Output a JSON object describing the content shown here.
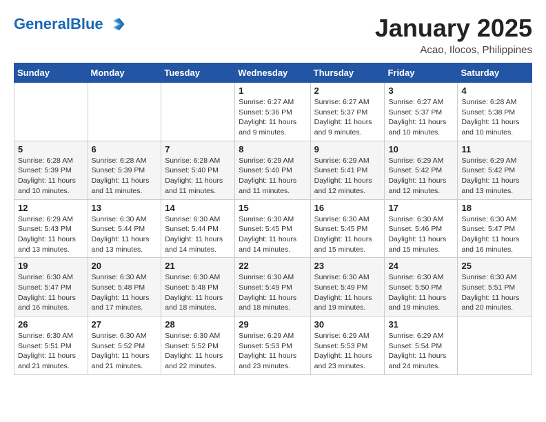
{
  "header": {
    "logo_line1": "General",
    "logo_line2": "Blue",
    "month": "January 2025",
    "location": "Acao, Ilocos, Philippines"
  },
  "weekdays": [
    "Sunday",
    "Monday",
    "Tuesday",
    "Wednesday",
    "Thursday",
    "Friday",
    "Saturday"
  ],
  "weeks": [
    [
      {
        "day": "",
        "detail": ""
      },
      {
        "day": "",
        "detail": ""
      },
      {
        "day": "",
        "detail": ""
      },
      {
        "day": "1",
        "detail": "Sunrise: 6:27 AM\nSunset: 5:36 PM\nDaylight: 11 hours and 9 minutes."
      },
      {
        "day": "2",
        "detail": "Sunrise: 6:27 AM\nSunset: 5:37 PM\nDaylight: 11 hours and 9 minutes."
      },
      {
        "day": "3",
        "detail": "Sunrise: 6:27 AM\nSunset: 5:37 PM\nDaylight: 11 hours and 10 minutes."
      },
      {
        "day": "4",
        "detail": "Sunrise: 6:28 AM\nSunset: 5:38 PM\nDaylight: 11 hours and 10 minutes."
      }
    ],
    [
      {
        "day": "5",
        "detail": "Sunrise: 6:28 AM\nSunset: 5:39 PM\nDaylight: 11 hours and 10 minutes."
      },
      {
        "day": "6",
        "detail": "Sunrise: 6:28 AM\nSunset: 5:39 PM\nDaylight: 11 hours and 11 minutes."
      },
      {
        "day": "7",
        "detail": "Sunrise: 6:28 AM\nSunset: 5:40 PM\nDaylight: 11 hours and 11 minutes."
      },
      {
        "day": "8",
        "detail": "Sunrise: 6:29 AM\nSunset: 5:40 PM\nDaylight: 11 hours and 11 minutes."
      },
      {
        "day": "9",
        "detail": "Sunrise: 6:29 AM\nSunset: 5:41 PM\nDaylight: 11 hours and 12 minutes."
      },
      {
        "day": "10",
        "detail": "Sunrise: 6:29 AM\nSunset: 5:42 PM\nDaylight: 11 hours and 12 minutes."
      },
      {
        "day": "11",
        "detail": "Sunrise: 6:29 AM\nSunset: 5:42 PM\nDaylight: 11 hours and 13 minutes."
      }
    ],
    [
      {
        "day": "12",
        "detail": "Sunrise: 6:29 AM\nSunset: 5:43 PM\nDaylight: 11 hours and 13 minutes."
      },
      {
        "day": "13",
        "detail": "Sunrise: 6:30 AM\nSunset: 5:44 PM\nDaylight: 11 hours and 13 minutes."
      },
      {
        "day": "14",
        "detail": "Sunrise: 6:30 AM\nSunset: 5:44 PM\nDaylight: 11 hours and 14 minutes."
      },
      {
        "day": "15",
        "detail": "Sunrise: 6:30 AM\nSunset: 5:45 PM\nDaylight: 11 hours and 14 minutes."
      },
      {
        "day": "16",
        "detail": "Sunrise: 6:30 AM\nSunset: 5:45 PM\nDaylight: 11 hours and 15 minutes."
      },
      {
        "day": "17",
        "detail": "Sunrise: 6:30 AM\nSunset: 5:46 PM\nDaylight: 11 hours and 15 minutes."
      },
      {
        "day": "18",
        "detail": "Sunrise: 6:30 AM\nSunset: 5:47 PM\nDaylight: 11 hours and 16 minutes."
      }
    ],
    [
      {
        "day": "19",
        "detail": "Sunrise: 6:30 AM\nSunset: 5:47 PM\nDaylight: 11 hours and 16 minutes."
      },
      {
        "day": "20",
        "detail": "Sunrise: 6:30 AM\nSunset: 5:48 PM\nDaylight: 11 hours and 17 minutes."
      },
      {
        "day": "21",
        "detail": "Sunrise: 6:30 AM\nSunset: 5:48 PM\nDaylight: 11 hours and 18 minutes."
      },
      {
        "day": "22",
        "detail": "Sunrise: 6:30 AM\nSunset: 5:49 PM\nDaylight: 11 hours and 18 minutes."
      },
      {
        "day": "23",
        "detail": "Sunrise: 6:30 AM\nSunset: 5:49 PM\nDaylight: 11 hours and 19 minutes."
      },
      {
        "day": "24",
        "detail": "Sunrise: 6:30 AM\nSunset: 5:50 PM\nDaylight: 11 hours and 19 minutes."
      },
      {
        "day": "25",
        "detail": "Sunrise: 6:30 AM\nSunset: 5:51 PM\nDaylight: 11 hours and 20 minutes."
      }
    ],
    [
      {
        "day": "26",
        "detail": "Sunrise: 6:30 AM\nSunset: 5:51 PM\nDaylight: 11 hours and 21 minutes."
      },
      {
        "day": "27",
        "detail": "Sunrise: 6:30 AM\nSunset: 5:52 PM\nDaylight: 11 hours and 21 minutes."
      },
      {
        "day": "28",
        "detail": "Sunrise: 6:30 AM\nSunset: 5:52 PM\nDaylight: 11 hours and 22 minutes."
      },
      {
        "day": "29",
        "detail": "Sunrise: 6:29 AM\nSunset: 5:53 PM\nDaylight: 11 hours and 23 minutes."
      },
      {
        "day": "30",
        "detail": "Sunrise: 6:29 AM\nSunset: 5:53 PM\nDaylight: 11 hours and 23 minutes."
      },
      {
        "day": "31",
        "detail": "Sunrise: 6:29 AM\nSunset: 5:54 PM\nDaylight: 11 hours and 24 minutes."
      },
      {
        "day": "",
        "detail": ""
      }
    ]
  ]
}
